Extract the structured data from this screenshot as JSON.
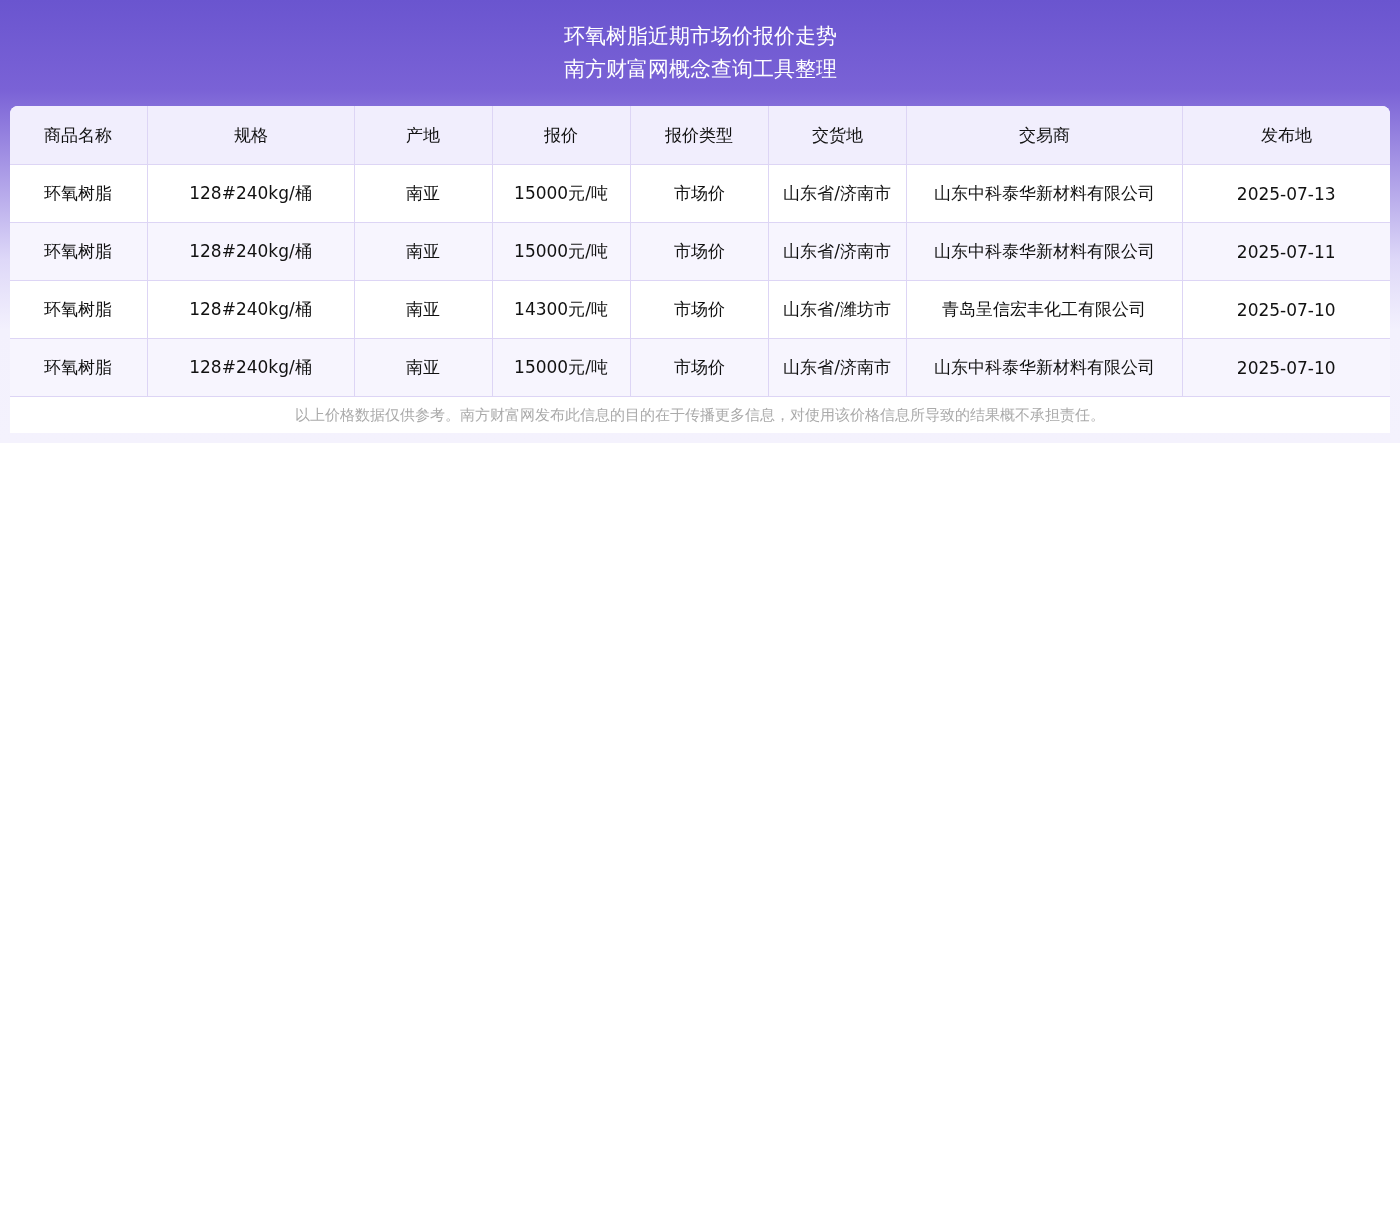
{
  "title_lines": [
    "环氧树脂近期市场价报价走势",
    "南方财富网概念查询工具整理"
  ],
  "table": {
    "columns": [
      "商品名称",
      "规格",
      "产地",
      "报价",
      "报价类型",
      "交货地",
      "交易商",
      "发布地"
    ],
    "rows": [
      [
        "环氧树脂",
        "128#240kg/桶",
        "南亚",
        "15000元/吨",
        "市场价",
        "山东省/济南市",
        "山东中科泰华新材料有限公司",
        "2025-07-13"
      ],
      [
        "环氧树脂",
        "128#240kg/桶",
        "南亚",
        "15000元/吨",
        "市场价",
        "山东省/济南市",
        "山东中科泰华新材料有限公司",
        "2025-07-11"
      ],
      [
        "环氧树脂",
        "128#240kg/桶",
        "南亚",
        "14300元/吨",
        "市场价",
        "山东省/潍坊市",
        "青岛呈信宏丰化工有限公司",
        "2025-07-10"
      ],
      [
        "环氧树脂",
        "128#240kg/桶",
        "南亚",
        "15000元/吨",
        "市场价",
        "山东省/济南市",
        "山东中科泰华新材料有限公司",
        "2025-07-10"
      ]
    ]
  },
  "disclaimer": "以上价格数据仅供参考。南方财富网发布此信息的目的在于传播更多信息，对使用该价格信息所导致的结果概不承担责任。"
}
